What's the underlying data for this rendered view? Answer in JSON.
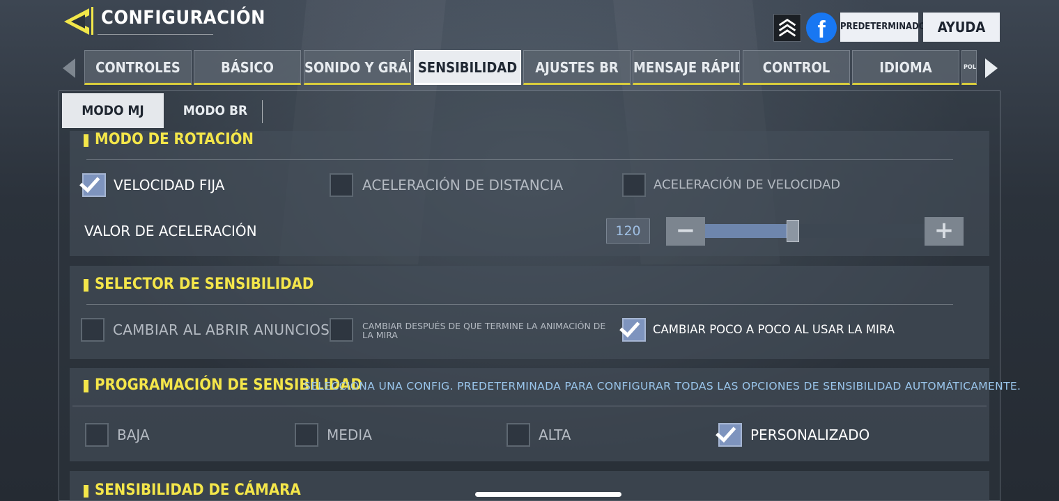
{
  "header": {
    "title": "CONFIGURACIÓN",
    "btn_default": "PREDETERMINADO",
    "btn_help": "AYUDA",
    "fb_glyph": "f"
  },
  "tabs": [
    {
      "label": "CONTROLES",
      "active": false
    },
    {
      "label": "BÁSICO",
      "active": false
    },
    {
      "label": "SONIDO Y GRÁFICOS",
      "active": false
    },
    {
      "label": "SENSIBILIDAD",
      "active": true
    },
    {
      "label": "AJUSTES BR",
      "active": false
    },
    {
      "label": "MENSAJE RÁPIDO",
      "active": false
    },
    {
      "label": "CONTROL",
      "active": false
    },
    {
      "label": "IDIOMA",
      "active": false
    },
    {
      "label": "POLÍ",
      "active": false
    }
  ],
  "subtabs": [
    {
      "label": "MODO MJ",
      "active": true
    },
    {
      "label": "MODO BR",
      "active": false
    }
  ],
  "rotation": {
    "title": "MODO DE ROTACIÓN",
    "options": [
      {
        "label": "VELOCIDAD FIJA",
        "checked": true
      },
      {
        "label": "ACELERACIÓN DE DISTANCIA",
        "checked": false
      },
      {
        "label": "ACELERACIÓN DE VELOCIDAD",
        "checked": false
      }
    ],
    "accel_label": "VALOR DE ACELERACIÓN",
    "accel_value": "120",
    "minus": "−",
    "plus": "+",
    "slider_fraction": 0.4
  },
  "selector": {
    "title": "SELECTOR DE SENSIBILIDAD",
    "options": [
      {
        "label": "CAMBIAR AL ABRIR ANUNCIOS",
        "checked": false
      },
      {
        "label": "CAMBIAR DESPUÉS DE QUE TERMINE LA ANIMACIÓN DE LA MIRA",
        "checked": false
      },
      {
        "label": "CAMBIAR POCO A POCO AL USAR LA MIRA",
        "checked": true
      }
    ]
  },
  "programming": {
    "title": "PROGRAMACIÓN DE SENSIBILIDAD",
    "description": "SELECCIONA UNA CONFIG. PREDETERMINADA PARA CONFIGURAR TODAS LAS OPCIONES DE SENSIBILIDAD AUTOMÁTICAMENTE.",
    "options": [
      {
        "label": "BAJA",
        "checked": false
      },
      {
        "label": "MEDIA",
        "checked": false
      },
      {
        "label": "ALTA",
        "checked": false
      },
      {
        "label": "PERSONALIZADO",
        "checked": true
      }
    ]
  },
  "camera": {
    "title": "SENSIBILIDAD DE CÁMARA"
  },
  "colors": {
    "accent_yellow": "#f4e64a",
    "checkbox_checked": "#7e94be",
    "facebook_blue": "#1877f2",
    "description_blue": "#9ac6ec"
  },
  "icons": [
    "back-arrow-icon",
    "rank-chevrons-icon",
    "facebook-icon",
    "tab-left-arrow-icon",
    "tab-right-arrow-icon",
    "checkmark-icon",
    "minus-icon",
    "plus-icon"
  ]
}
